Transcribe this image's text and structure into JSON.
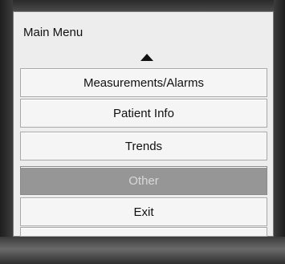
{
  "menu": {
    "title": "Main Menu",
    "scroll_up_icon": "triangle-up-icon",
    "items": [
      {
        "label": "Measurements/Alarms",
        "selected": false
      },
      {
        "label": "Patient Info",
        "selected": false
      },
      {
        "label": "Trends",
        "selected": false
      },
      {
        "label": "Other",
        "selected": true
      },
      {
        "label": "Exit",
        "selected": false
      }
    ]
  },
  "colors": {
    "screen_background": "#ededed",
    "item_background": "#f5f5f5",
    "selected_background": "#969696",
    "selected_text": "#d8d8d8",
    "text": "#111111"
  }
}
